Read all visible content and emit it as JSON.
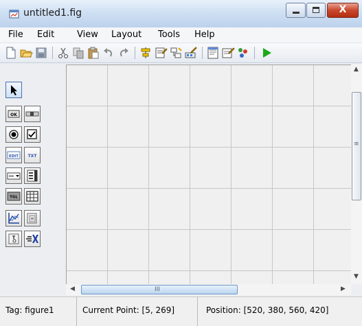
{
  "window": {
    "title": "untitled1.fig",
    "controls": {
      "minimize": "minimize",
      "maximize": "maximize",
      "close": "X"
    }
  },
  "menu": [
    "File",
    "Edit",
    "View",
    "Layout",
    "Tools",
    "Help"
  ],
  "toolbar": [
    "new-figure-icon",
    "open-file-icon",
    "save-icon",
    "cut-icon",
    "copy-icon",
    "paste-icon",
    "undo-icon",
    "redo-icon",
    "align-objects-icon",
    "menu-editor-icon",
    "tab-order-editor-icon",
    "toolbar-editor-icon",
    "m-file-editor-icon",
    "property-inspector-icon",
    "object-browser-icon",
    "run-figure-icon"
  ],
  "palette": {
    "select_tool": "select-arrow-icon",
    "rows": [
      [
        "push-button-icon",
        "slider-icon"
      ],
      [
        "radio-button-icon",
        "check-box-icon"
      ],
      [
        "edit-text-icon",
        "static-text-icon"
      ],
      [
        "popup-menu-icon",
        "listbox-icon"
      ],
      [
        "toggle-button-icon",
        "table-icon"
      ],
      [
        "axes-icon",
        "panel-icon"
      ],
      [
        "button-group-icon",
        "activex-control-icon"
      ]
    ],
    "labels": {
      "push_button": "OK",
      "edit_text": "EDIT",
      "static_text": "TXT",
      "toggle_button": "TGL",
      "button_group": "T"
    }
  },
  "colors": {
    "title_gradient_top": "#e8f1fb",
    "close_button": "#c9482c",
    "run_green": "#1ba81b",
    "canvas_bg": "#f0f0f0",
    "grid_line": "#c6c6c6"
  },
  "scrollbar": {
    "h_grip": "III",
    "v_grip": "≡"
  },
  "status": {
    "tag": "Tag: figure1",
    "current_point": "Current Point:  [5, 269]",
    "position": "Position: [520, 380, 560, 420]"
  }
}
